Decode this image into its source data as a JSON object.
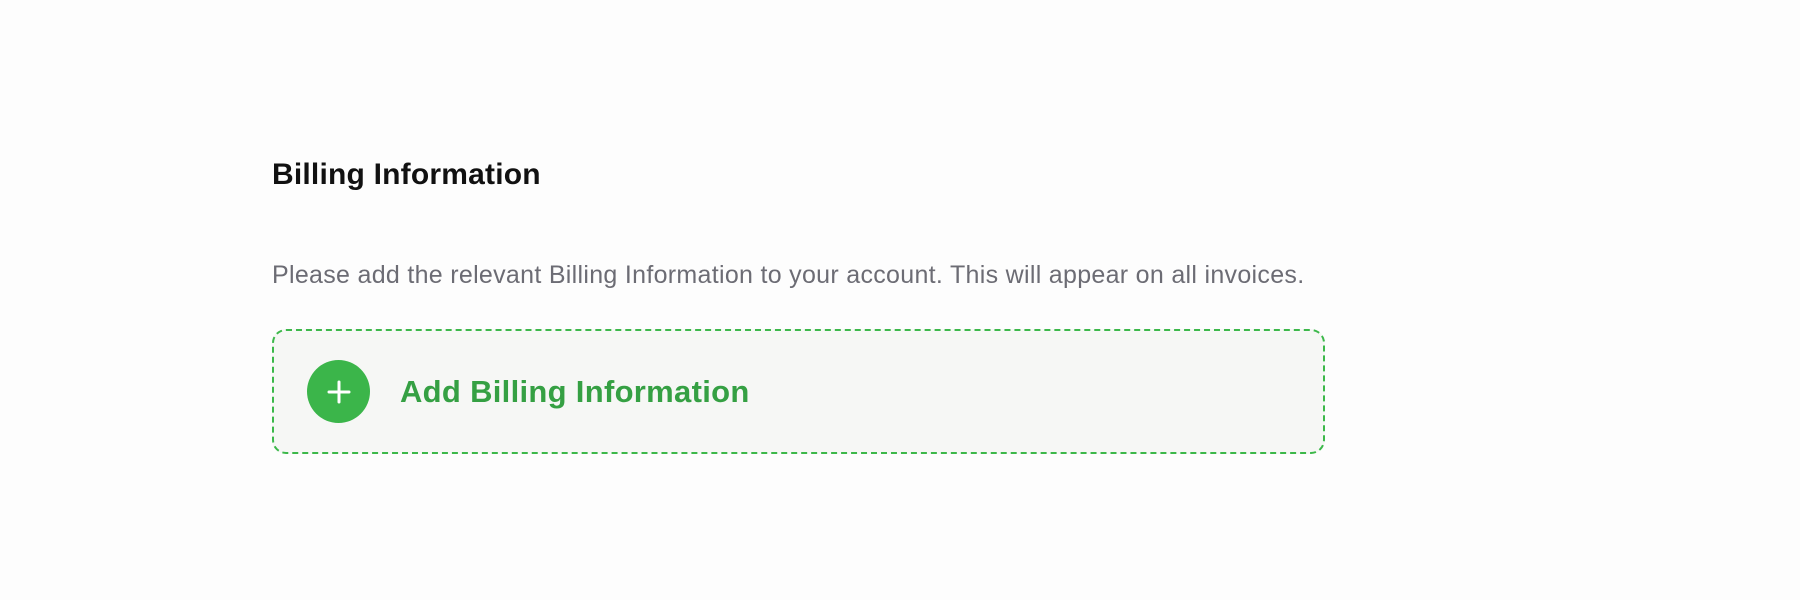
{
  "billing": {
    "title": "Billing Information",
    "description": "Please add the relevant Billing Information to your account. This will appear on all invoices.",
    "add_button": {
      "label": "Add Billing Information",
      "icon": "plus-icon"
    }
  },
  "colors": {
    "accent": "#3bb54a",
    "accent_text": "#35a043",
    "card_background": "#f6f7f5",
    "title_text": "#111111",
    "description_text": "#6c6c74",
    "page_background": "#fdfdfd"
  }
}
